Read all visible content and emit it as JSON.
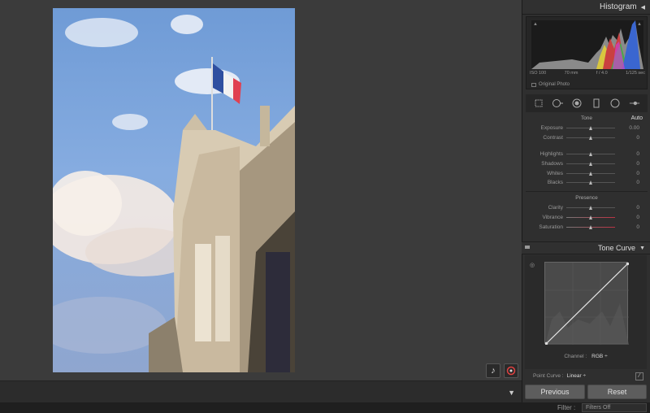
{
  "histogram": {
    "title": "Histogram",
    "iso": "ISO 100",
    "focal": "70 mm",
    "aperture": "f / 4.0",
    "shutter": "1/125 sec",
    "original_photo": "Original Photo"
  },
  "basic": {
    "tone_label": "Tone",
    "auto_label": "Auto",
    "presence_label": "Presence",
    "tone_sliders": [
      {
        "label": "Exposure",
        "value": "0.00"
      },
      {
        "label": "Contrast",
        "value": "0"
      }
    ],
    "tone_sliders2": [
      {
        "label": "Highlights",
        "value": "0"
      },
      {
        "label": "Shadows",
        "value": "0"
      },
      {
        "label": "Whites",
        "value": "0"
      },
      {
        "label": "Blacks",
        "value": "0"
      }
    ],
    "presence_sliders": [
      {
        "label": "Clarity",
        "value": "0"
      },
      {
        "label": "Vibrance",
        "value": "0"
      },
      {
        "label": "Saturation",
        "value": "0"
      }
    ]
  },
  "tone_curve": {
    "title": "Tone Curve",
    "channel_label": "Channel :",
    "channel_value": "RGB ÷",
    "point_curve_label": "Point Curve :",
    "point_curve_value": "Linear ÷"
  },
  "buttons": {
    "previous": "Previous",
    "reset": "Reset"
  },
  "filter": {
    "label": "Filter :",
    "value": "Filters Off"
  },
  "colors": {
    "panel_bg": "#2f2f2f",
    "canvas_bg": "#3b3b3b",
    "button_bg": "#5d5d5d"
  }
}
